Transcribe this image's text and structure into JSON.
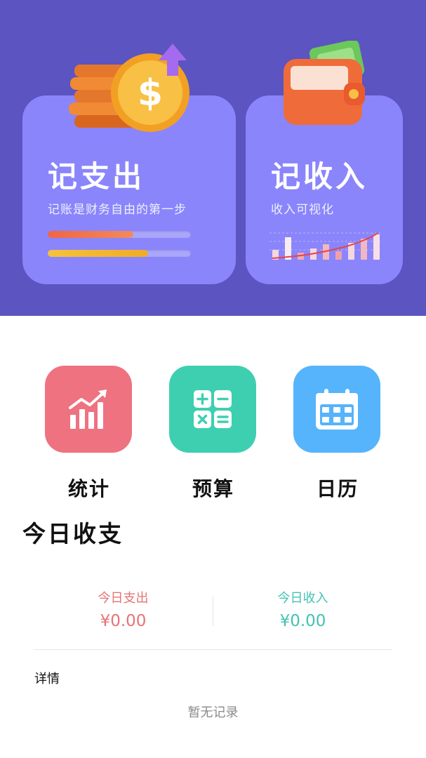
{
  "cards": {
    "expense": {
      "title": "记支出",
      "subtitle": "记账是财务自由的第一步",
      "progress": [
        0.6,
        0.7
      ]
    },
    "income": {
      "title": "记收入",
      "subtitle": "收入可视化"
    }
  },
  "shortcuts": [
    {
      "label": "统计",
      "icon": "chart-icon"
    },
    {
      "label": "预算",
      "icon": "calculator-icon"
    },
    {
      "label": "日历",
      "icon": "calendar-icon"
    }
  ],
  "today": {
    "title": "今日收支",
    "expense_label": "今日支出",
    "expense_value": "¥0.00",
    "income_label": "今日收入",
    "income_value": "¥0.00"
  },
  "details": {
    "label": "详情",
    "empty_text": "暂无记录"
  },
  "colors": {
    "header_bg": "#5b54c1",
    "card_bg": "#8a85fb",
    "stats_tile": "#ee7280",
    "budget_tile": "#3ecfb0",
    "calendar_tile": "#55b4fb",
    "expense_text": "#e57474",
    "income_text": "#44c1b3"
  }
}
